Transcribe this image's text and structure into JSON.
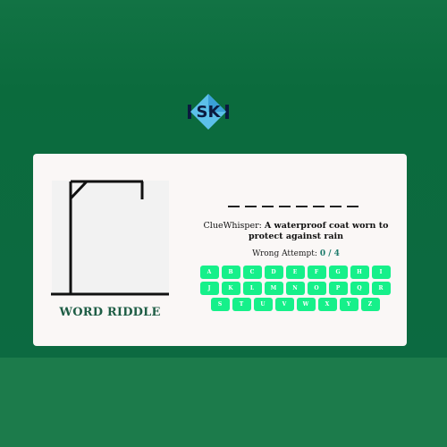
{
  "game": {
    "title": "WORD RIDDLE",
    "word_length": 8,
    "clue_label": "ClueWhisper:",
    "clue_text": "A waterproof coat worn to protect against rain",
    "attempts_label": "Wrong Attempt:",
    "attempts_count": "0 / 4"
  },
  "keyboard": {
    "rows": [
      [
        "A",
        "B",
        "C",
        "D",
        "E",
        "F",
        "G",
        "H",
        "I"
      ],
      [
        "J",
        "K",
        "L",
        "M",
        "N",
        "O",
        "P",
        "Q",
        "R"
      ],
      [
        "S",
        "T",
        "U",
        "V",
        "W",
        "X",
        "Y",
        "Z"
      ]
    ]
  },
  "colors": {
    "background": "#1c7a4c",
    "card": "#faf7f6",
    "key": "#16f08a",
    "title": "#1e5d45",
    "attempt_count": "#1c7a6b",
    "logo": "#3fa9e3"
  },
  "icons": {
    "logo": "sk-diamond-logo-icon"
  }
}
